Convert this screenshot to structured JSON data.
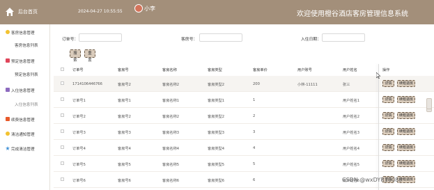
{
  "topbar": {
    "home_label": "后台首页",
    "datetime": "2024-04-27 10:55:55",
    "username": "小李",
    "site_title": "欢迎使用橙谷酒店客房管理信息系统"
  },
  "sidebar": {
    "items": [
      {
        "label": "客房信息管理",
        "icon": "circle-icon",
        "color": "#f2c230"
      },
      {
        "label": "客房信息列表",
        "sub": true
      },
      {
        "label": "预定信息管理",
        "icon": "bookmark-icon",
        "color": "#e0455a"
      },
      {
        "label": "预定信息列表",
        "sub": true
      },
      {
        "label": "入住信息管理",
        "icon": "document-icon",
        "color": "#8d6bbf"
      },
      {
        "label": "入住信息列表",
        "sub": true,
        "active": true
      },
      {
        "label": "续费信息管理",
        "icon": "grid-icon",
        "color": "#e85a2a"
      },
      {
        "label": "清洁通知管理",
        "icon": "bell-icon",
        "color": "#f2c230"
      },
      {
        "label": "完成清洁管理",
        "icon": "star-icon",
        "color": "#3d8fd6"
      }
    ]
  },
  "filters": {
    "order_label": "订单号：",
    "room_label": "客房号：",
    "checkin_label": "入住日期：",
    "search_button": "搜索",
    "reset_button": "重置"
  },
  "table": {
    "columns": [
      "订单号",
      "客房号",
      "客房名称",
      "客房类型",
      "客房单价",
      "用户账号",
      "用户姓名",
      "操作"
    ],
    "detail_button": "详情",
    "checkout_button": "续租退房",
    "rows": [
      [
        "1714106446766",
        "客房号2",
        "客房名称2",
        "客房类型2",
        "200",
        "小林-11111",
        "张三"
      ],
      [
        "订单号1",
        "客房号1",
        "客房名称1",
        "客房类型1",
        "1",
        "",
        "用户姓名1"
      ],
      [
        "订单号2",
        "客房号2",
        "客房名称2",
        "客房类型2",
        "2",
        "",
        "用户姓名2"
      ],
      [
        "订单号3",
        "客房号3",
        "客房名称3",
        "客房类型3",
        "3",
        "",
        "用户姓名3"
      ],
      [
        "订单号4",
        "客房号4",
        "客房名称4",
        "客房类型4",
        "4",
        "",
        "用户姓名4"
      ],
      [
        "订单号5",
        "客房号5",
        "客房名称5",
        "客房类型5",
        "5",
        "",
        "用户姓名5"
      ],
      [
        "订单号6",
        "客房号6",
        "客房名称6",
        "客房类型6",
        "6",
        "",
        "用户姓名6"
      ]
    ]
  },
  "watermark": "CSDN @wxDYR10088"
}
